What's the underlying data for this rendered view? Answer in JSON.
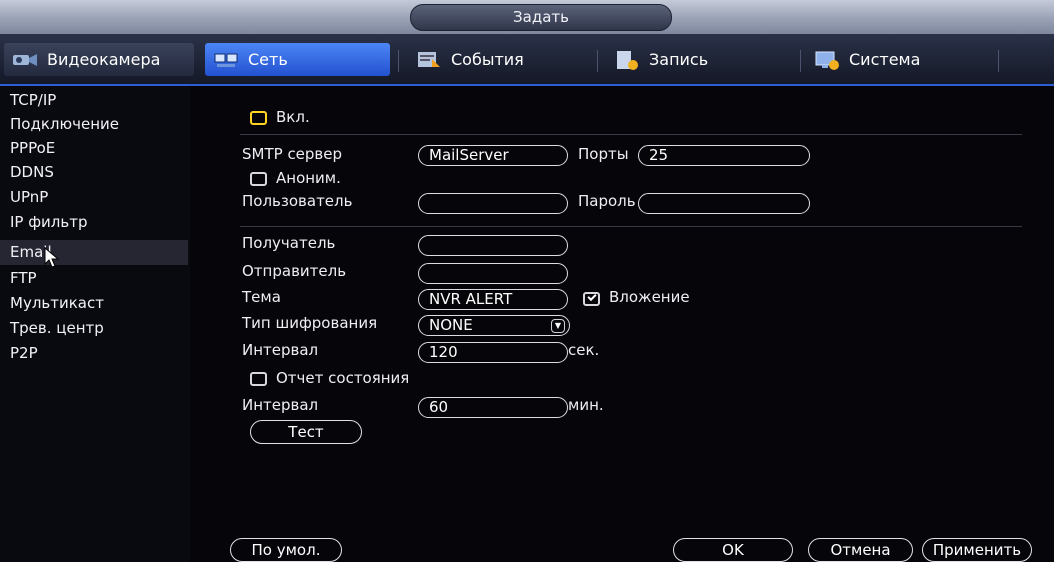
{
  "window": {
    "title": "Задать"
  },
  "tabs": [
    {
      "label": "Видеокамера",
      "icon": "camera-icon",
      "active": false
    },
    {
      "label": "Сеть",
      "icon": "network-icon",
      "active": true
    },
    {
      "label": "События",
      "icon": "events-icon",
      "active": false
    },
    {
      "label": "Запись",
      "icon": "record-icon",
      "active": false
    },
    {
      "label": "Система",
      "icon": "system-icon",
      "active": false
    }
  ],
  "sidebar": {
    "items": [
      "TCP/IP",
      "Подключение",
      "PPPoE",
      "DDNS",
      "UPnP",
      "IP фильтр",
      "Email",
      "FTP",
      "Мультикаст",
      "Трев. центр",
      "P2P"
    ],
    "selected": "Email"
  },
  "email": {
    "enable_label": "Вкл.",
    "enable_checked": false,
    "smtp_label": "SMTP сервер",
    "smtp_value": "MailServer",
    "port_label": "Порты",
    "port_value": "25",
    "anon_label": "Аноним.",
    "anon_checked": false,
    "user_label": "Пользователь",
    "user_value": "",
    "password_label": "Пароль",
    "password_value": "",
    "recipient_label": "Получатель",
    "recipient_value": "",
    "sender_label": "Отправитель",
    "sender_value": "",
    "subject_label": "Тема",
    "subject_value": "NVR ALERT",
    "attachment_label": "Вложение",
    "attachment_checked": true,
    "encryption_label": "Тип шифрования",
    "encryption_value": "NONE",
    "interval_label": "Интервал",
    "interval_value": "120",
    "interval_unit": "сек.",
    "health_label": "Отчет состояния",
    "health_checked": false,
    "health_interval_label": "Интервал",
    "health_interval_value": "60",
    "health_interval_unit": "мин.",
    "test_button": "Тест"
  },
  "footer": {
    "default_button": "По умол.",
    "ok_button": "OK",
    "cancel_button": "Отмена",
    "apply_button": "Применить"
  },
  "colors": {
    "accent": "#2f63d8",
    "enable_checkbox": "#ffd224",
    "selected_row": "#262633"
  }
}
